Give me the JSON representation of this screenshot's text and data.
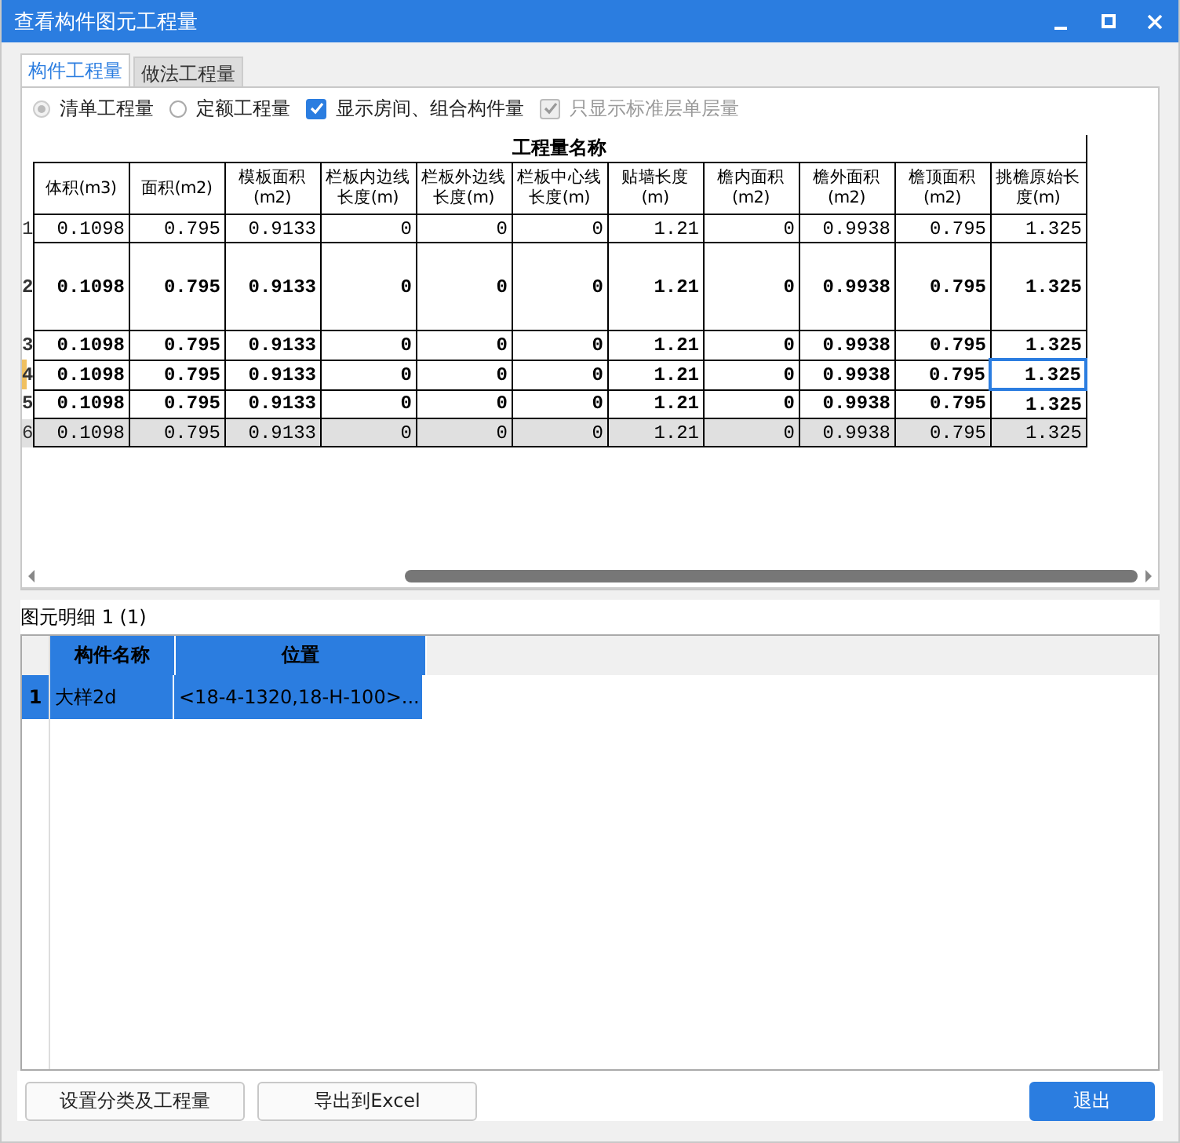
{
  "window": {
    "title": "查看构件图元工程量"
  },
  "tabs": [
    {
      "label": "构件工程量",
      "selected": true
    },
    {
      "label": "做法工程量",
      "selected": false
    }
  ],
  "options": [
    {
      "kind": "radio",
      "label": "清单工程量",
      "checked": true,
      "disabled": true
    },
    {
      "kind": "radio",
      "label": "定额工程量",
      "checked": false,
      "disabled": false
    },
    {
      "kind": "checkbox",
      "label": "显示房间、组合构件量",
      "checked": true,
      "disabled": false
    },
    {
      "kind": "checkbox",
      "label": "只显示标准层单层量",
      "checked": true,
      "disabled": true
    }
  ],
  "table": {
    "group_title": "工程量名称",
    "columns": [
      "体积(m3)",
      "面积(m2)",
      "模板面积(m2)",
      "栏板内边线长度(m)",
      "栏板外边线长度(m)",
      "栏板中心线长度(m)",
      "贴墙长度(m)",
      "檐内面积(m2)",
      "檐外面积(m2)",
      "檐顶面积(m2)",
      "挑檐原始长度(m)"
    ],
    "rows": [
      {
        "number": "1",
        "kind": "plain",
        "tall": false,
        "selected": false,
        "cells": [
          "0.1098",
          "0.795",
          "0.9133",
          "0",
          "0",
          "0",
          "1.21",
          "0",
          "0.9938",
          "0.795",
          "1.325"
        ]
      },
      {
        "number": "2",
        "kind": "bold",
        "tall": true,
        "selected": false,
        "cells": [
          "0.1098",
          "0.795",
          "0.9133",
          "0",
          "0",
          "0",
          "1.21",
          "0",
          "0.9938",
          "0.795",
          "1.325"
        ]
      },
      {
        "number": "3",
        "kind": "bold",
        "tall": false,
        "selected": false,
        "cells": [
          "0.1098",
          "0.795",
          "0.9133",
          "0",
          "0",
          "0",
          "1.21",
          "0",
          "0.9938",
          "0.795",
          "1.325"
        ]
      },
      {
        "number": "4",
        "kind": "bold",
        "tall": false,
        "selected": true,
        "cells": [
          "0.1098",
          "0.795",
          "0.9133",
          "0",
          "0",
          "0",
          "1.21",
          "0",
          "0.9938",
          "0.795",
          "1.325"
        ]
      },
      {
        "number": "5",
        "kind": "bold",
        "tall": false,
        "selected": false,
        "cells": [
          "0.1098",
          "0.795",
          "0.9133",
          "0",
          "0",
          "0",
          "1.21",
          "0",
          "0.9938",
          "0.795",
          "1.325"
        ]
      },
      {
        "number": "6",
        "kind": "total",
        "tall": false,
        "selected": false,
        "cells": [
          "0.1098",
          "0.795",
          "0.9133",
          "0",
          "0",
          "0",
          "1.21",
          "0",
          "0.9938",
          "0.795",
          "1.325"
        ]
      }
    ]
  },
  "detail": {
    "title": "图元明细  1 (1)",
    "columns": [
      "构件名称",
      "位置"
    ],
    "rows": [
      {
        "number": "1",
        "selected": true,
        "cells": [
          "大样2d",
          "<18-4-1320,18-H-100>..."
        ]
      }
    ]
  },
  "buttons": [
    {
      "label": "设置分类及工程量",
      "kind": "default"
    },
    {
      "label": "导出到Excel",
      "kind": "default"
    },
    {
      "label": "退出",
      "kind": "primary"
    }
  ]
}
